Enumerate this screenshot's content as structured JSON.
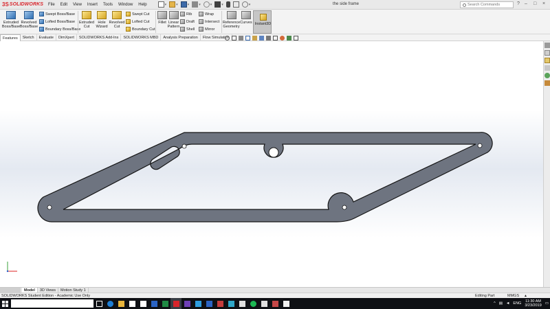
{
  "app": {
    "logo_ds": "3S",
    "logo_text": "SOLIDWORKS",
    "document_title": "the side frame",
    "menus": [
      "File",
      "Edit",
      "View",
      "Insert",
      "Tools",
      "Window",
      "Help"
    ],
    "search_placeholder": "Search Commands",
    "window_controls": {
      "help": "?",
      "minimize": "–",
      "restore": "□",
      "close": "×"
    }
  },
  "quick_access_icons": [
    "new-document-icon",
    "open-folder-icon",
    "save-icon",
    "print-icon",
    "undo-icon",
    "select-pointer-icon",
    "rebuild-icon",
    "file-properties-icon",
    "options-gear-icon"
  ],
  "command_manager": {
    "extruded_boss": "Extruded Boss/Base",
    "revolved_boss": "Revolved Boss/Base",
    "swept_boss": "Swept Boss/Base",
    "lofted_boss": "Lofted Boss/Base",
    "boundary_boss": "Boundary Boss/Base",
    "extruded_cut": "Extruded Cut",
    "hole_wizard": "Hole Wizard",
    "revolved_cut": "Revolved Cut",
    "swept_cut": "Swept Cut",
    "lofted_cut": "Lofted Cut",
    "boundary_cut": "Boundary Cut",
    "fillet": "Fillet",
    "linear_pattern": "Linear Pattern",
    "rib": "Rib",
    "draft": "Draft",
    "shell": "Shell",
    "wrap": "Wrap",
    "intersect": "Intersect",
    "mirror": "Mirror",
    "reference_geometry": "Reference Geometry",
    "curves": "Curves",
    "instant3d": "Instant3D"
  },
  "tabs": [
    "Features",
    "Sketch",
    "Evaluate",
    "DimXpert",
    "SOLIDWORKS Add-Ins",
    "SOLIDWORKS MBD",
    "Analysis Preparation",
    "Flow Simulation"
  ],
  "active_tab": "Features",
  "model_tabs": [
    "Model",
    "3D Views",
    "Motion Study 1"
  ],
  "active_model_tab": "Model",
  "status": {
    "left": "SOLIDWORKS Student Edition - Academic Use Only",
    "mode": "Editing Part",
    "units": "MMGS"
  },
  "taskbar": {
    "search_placeholder": "",
    "apps": [
      "task-view-icon",
      "edge-icon",
      "file-explorer-icon",
      "r-studio-icon",
      "mail-icon",
      "word-icon",
      "excel-icon",
      "solidworks-icon",
      "visual-studio-icon",
      "app-icon",
      "app-icon",
      "app-icon",
      "app-icon",
      "app-icon",
      "spotify-icon",
      "app-icon",
      "app-icon",
      "app-icon"
    ],
    "language": "ENG",
    "time": "11:30 AM",
    "date": "3/23/2019"
  },
  "colors": {
    "part_fill": "#6e7480",
    "part_edge": "#151515",
    "brand_red": "#d8242b",
    "taskbar": "#0f1115"
  }
}
